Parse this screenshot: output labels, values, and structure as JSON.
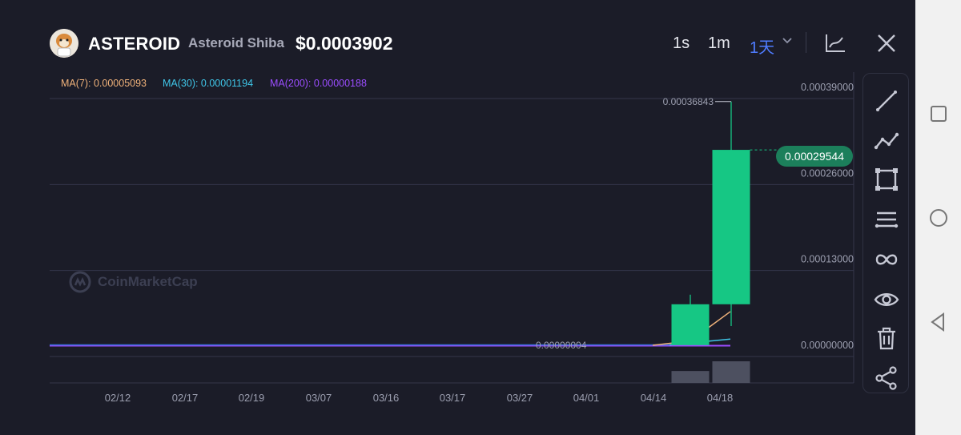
{
  "header": {
    "symbol": "ASTEROID",
    "name": "Asteroid Shiba",
    "price": "$0.0003902",
    "timeframes": [
      {
        "label": "1s",
        "active": false
      },
      {
        "label": "1m",
        "active": false
      },
      {
        "label": "1天",
        "active": true
      }
    ]
  },
  "ma_legend": [
    {
      "label": "MA(7): 0.00005093",
      "color": "#f0b27a"
    },
    {
      "label": "MA(30): 0.00001194",
      "color": "#3fc6e8"
    },
    {
      "label": "MA(200): 0.00000188",
      "color": "#9b4dff"
    }
  ],
  "watermark": "CoinMarketCap",
  "price_tag": "0.00029544",
  "colors": {
    "up": "#16c784",
    "grid": "#34364a",
    "text": "#9c9fb0",
    "volume": "#4d5060"
  },
  "tools": [
    "line-tool-icon",
    "polyline-tool-icon",
    "rectangle-tool-icon",
    "fib-levels-icon",
    "infinite-line-icon",
    "visibility-eye-icon",
    "trash-icon",
    "share-icon"
  ],
  "chart_data": {
    "type": "candlestick",
    "y_ticks": [
      "0.00039000",
      "0.00026000",
      "0.00013000",
      "0.00000000"
    ],
    "ylim": [
      0,
      0.00039
    ],
    "x_tick_labels": [
      "02/12",
      "02/17",
      "02/19",
      "03/07",
      "03/16",
      "03/17",
      "03/27",
      "04/01",
      "04/14",
      "04/18"
    ],
    "candles": [
      {
        "date": "04/14",
        "open": 2e-07,
        "high": 7.65e-05,
        "low": 2e-07,
        "close": 6.2e-05
      },
      {
        "date": "04/18",
        "open": 6.2e-05,
        "high": 0.00036843,
        "low": 2.9e-05,
        "close": 0.00029544
      }
    ],
    "annotations": {
      "high_label": "0.00036843",
      "low_label": "0.00000004"
    },
    "volume": [
      {
        "date": "04/14",
        "rel": 0.55
      },
      {
        "date": "04/18",
        "rel": 1.0
      }
    ]
  }
}
